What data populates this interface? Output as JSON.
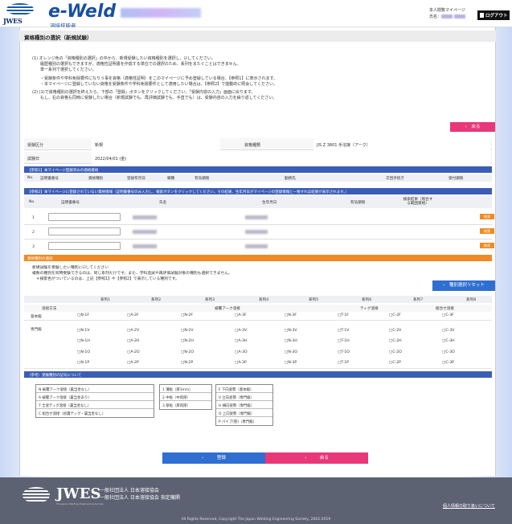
{
  "header": {
    "logo_text": "JWES",
    "app_name": "e-Weld",
    "app_sub": "溶接技能者",
    "mypage_label": "本人閲覧マイページ",
    "name_label": "氏名：",
    "logout_label": "ログアウト"
  },
  "page_title": "資格種別の選択（新規試験）",
  "instructions": [
    "(1) オレンジ色の「資格種別の選択」の中から、新規受験したい資格種別を選択し、☑してください。",
    "　　履歴種別の選択もできますが、適格性証明書を作成する単位での選択のため、系列をまたぐことはできません。",
    "　　単一系列で選択してください。",
    "",
    "　　・受験条件や学科免除要件になりう事を資格（適格性証明）をこのマイページに予め登録している場合、【参照1】に表示されます。",
    "　　・本マイページに登録していない資格を受験条件や学科免除要件として適用したい場合は、【参照2】で能動的に照会してください。",
    "",
    "(2) (1)で資格種別の選択を終えたら、下部の「登録」ボタンをクリックしてください。「受験内容の入力」画面に戻ります。",
    "　　もし、右の資格も同時に受験したい場合（新規試験でも、再評価試験でも、手直でも）は、受験内容の入力を繰り返してください。"
  ],
  "buttons": {
    "back": "戻る",
    "register": "登録",
    "reset": "種別選択リセット",
    "search": "検索"
  },
  "info": {
    "kubun_label": "受験区分",
    "kubun_value": "新規",
    "shubetsu_label": "資格種類",
    "shubetsu_value": "JIS Z 3801 手溶接（アーク）",
    "date_label": "試験日",
    "date_value": "2022/04/01 (金)"
  },
  "ref1": {
    "bar": "【参照1】本マイページ登録済みの適格資格",
    "headers": [
      "No.",
      "証明書番号",
      "資格種別",
      "登録年月日",
      "職種",
      "有効期限",
      "勤務先",
      "次回手続き",
      "受付期限"
    ]
  },
  "ref2": {
    "bar": "【参照2】本マイページに登録されていない資格情報（証明書番号のみ入力し、検索ボタンをクリックしてください。その結果、生年月日がマイページの登録情報と一致すれば結果が表示されます。）",
    "headers": [
      "No.",
      "証明書番号",
      "氏名",
      "生年月日",
      "有効期限",
      "検索結果（照合する範囲資格）"
    ],
    "rows": [
      "1",
      "2",
      "3"
    ]
  },
  "select": {
    "bar": "資格種別の選択",
    "note": [
      "新規試験を受験したい種別に☑してください",
      "複数の種別を同時受験できるのは、同じ系列だけです。また、学科追試や再評価試験対象の種別も選択できません。",
      "　＊検索色がついているのは、上記【参照1】や【参照2】で表示している種別です。"
    ],
    "series": [
      "系列1",
      "系列2",
      "系列3",
      "系列4",
      "系列5",
      "系列6",
      "系列7",
      "系列8"
    ],
    "method_label": "溶接方法",
    "method_arc": "被覆アーク溶接",
    "method_tig": "ティグ溶接",
    "method_comb": "組合せ溶接",
    "basic_label": "基本級",
    "special_label": "専門級",
    "basic": [
      "□N-1F",
      "□A-2F",
      "□N-2F",
      "□A-3F",
      "□N-3F",
      "□T-1F",
      "□C-2F",
      "□C-3F"
    ],
    "special": [
      [
        "□N-1V",
        "□A-2V",
        "□N-2V",
        "□A-3V",
        "□N-3V",
        "□T-1V",
        "□C-2V",
        "□C-3V"
      ],
      [
        "□N-1H",
        "□A-2H",
        "□N-2H",
        "□A-3H",
        "□N-3H",
        "□T-1H",
        "□C-2H",
        "□C-3H"
      ],
      [
        "□N-1O",
        "□A-2O",
        "□N-2O",
        "□A-3O",
        "□N-3O",
        "□T-1O",
        "□C-2O",
        "□C-3O"
      ],
      [
        "□N-1P",
        "□A-2P",
        "□N-2P",
        "□A-3P",
        "□N-3P",
        "□T-1P",
        "□C-2P",
        "□C-3P"
      ]
    ]
  },
  "ref_legend": {
    "bar": "（参考）受験種別の記号について",
    "col1": [
      "N 被覆アーク溶接（裏当金なし）",
      "A 被覆アーク溶接（裏当金あり）",
      "T 全溶ティグ溶接（裏当金なし）",
      "C 組合せ溶接（初層ティグ・裏当金なし）"
    ],
    "col2": [
      "1 薄板（厚3mm）",
      "2 中板（中肉厚）",
      "3 厚板（厚肉厚）"
    ],
    "col3": [
      "F 下向姿勢（基本級）",
      "V 立向姿勢（専門級）",
      "H 横向姿勢（専門級）",
      "O 上向姿勢（専門級）",
      "P パイプ(管)（専門級）"
    ]
  },
  "footer": {
    "logo": "JWES",
    "sub": "The Japan Welding Engineering Society",
    "org1": "一般社団法人 日本溶接協会",
    "org2": "一般社団法人 日本溶接協会 指定機関",
    "link": "個人情報の取り扱いについて",
    "copyright": "All Rights Reserved, Copyright The Japan Welding Engineering Society, 2002-2019"
  }
}
